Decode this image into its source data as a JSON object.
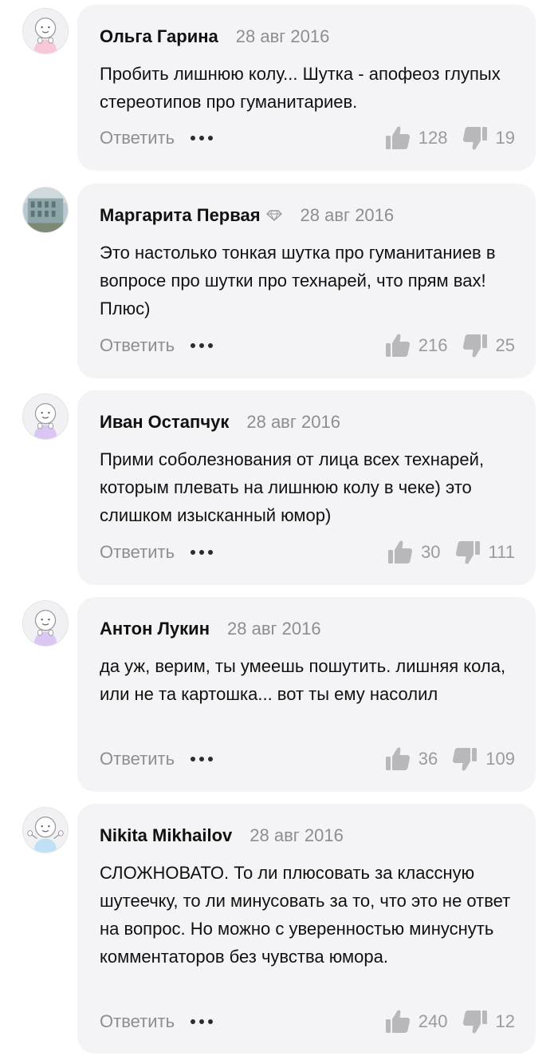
{
  "actions": {
    "reply_label": "Ответить"
  },
  "comments": [
    {
      "author": "Ольга Гарина",
      "date": "28 авг 2016",
      "text": "Пробить лишнюю колу... Шутка - апофеоз глупых стереотипов про гуманитариев.",
      "likes": "128",
      "dislikes": "19",
      "avatar": "default-avatar-pink"
    },
    {
      "author": "Маргарита Первая",
      "date": "28 авг 2016",
      "text": "Это настолько тонкая шутка про гуманитаниев в вопросе про шутки про технарей, что прям вах! Плюс)",
      "likes": "216",
      "dislikes": "25",
      "avatar": "photo-avatar-building",
      "badge": "diamond-icon"
    },
    {
      "author": "Иван Остапчук",
      "date": "28 авг 2016",
      "text": "Прими соболезнования от лица всех технарей, которым плевать на лишнюю колу в чеке) это слишком изысканный юмор)",
      "likes": "30",
      "dislikes": "111",
      "avatar": "default-avatar-lilac"
    },
    {
      "author": "Антон Лукин",
      "date": "28 авг 2016",
      "text": "да уж, верим, ты умеешь пошутить. лишняя кола, или не та картошка... вот ты ему насолил",
      "likes": "36",
      "dislikes": "109",
      "avatar": "default-avatar-lilac"
    },
    {
      "author": "Nikita Mikhailov",
      "date": "28 авг 2016",
      "text": "СЛОЖНОВАТО. То ли плюсовать за классную шутеечку, то ли минусовать за то, что это не ответ на вопрос. Но можно с уверенностью минуснуть комментаторов без чувства юмора.",
      "likes": "240",
      "dislikes": "12",
      "avatar": "default-avatar-blue"
    }
  ],
  "colors": {
    "bubble": "#f4f4f6",
    "muted_text": "#8d8d92",
    "icon_gray": "#b8b8bc",
    "avatar_pink": "#f6c8d8",
    "avatar_lilac": "#d9c6f2",
    "avatar_blue": "#bfe0f5"
  }
}
